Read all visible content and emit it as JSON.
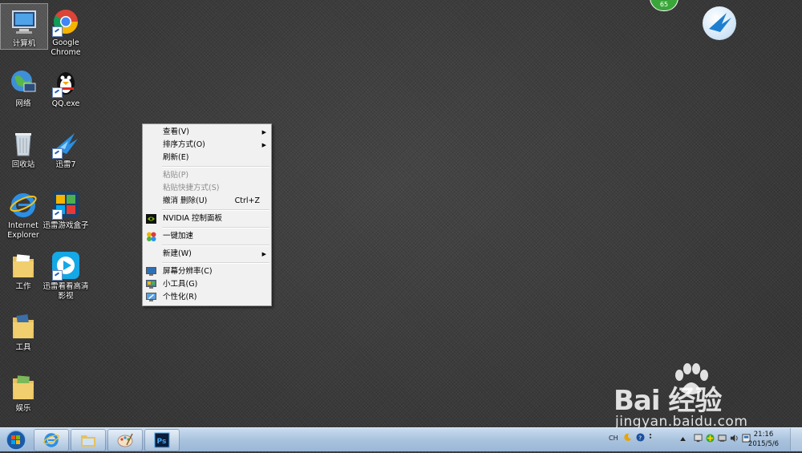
{
  "desktop": {
    "icons": [
      {
        "label": "计算机"
      },
      {
        "label": "Google Chrome"
      },
      {
        "label": "网络"
      },
      {
        "label": "QQ.exe"
      },
      {
        "label": "回收站"
      },
      {
        "label": "迅雷7"
      },
      {
        "label": "Internet Explorer"
      },
      {
        "label": "迅雷游戏盒子"
      },
      {
        "label": "工作"
      },
      {
        "label": "迅雷看看高清影视"
      },
      {
        "label": "工具"
      },
      {
        "label": "娱乐"
      }
    ],
    "badge_count": "65"
  },
  "context_menu": {
    "items": [
      {
        "label": "查看(V)"
      },
      {
        "label": "排序方式(O)"
      },
      {
        "label": "刷新(E)"
      },
      {
        "label": "粘贴(P)"
      },
      {
        "label": "粘贴快捷方式(S)"
      },
      {
        "label": "撤消 删除(U)",
        "shortcut": "Ctrl+Z"
      },
      {
        "label": "NVIDIA 控制面板"
      },
      {
        "label": "一键加速"
      },
      {
        "label": "新建(W)"
      },
      {
        "label": "屏幕分辨率(C)"
      },
      {
        "label": "小工具(G)"
      },
      {
        "label": "个性化(R)"
      }
    ]
  },
  "taskbar": {
    "tray": {
      "lang": "CH"
    },
    "clock": {
      "time": "21:16",
      "date": "2015/5/6"
    }
  },
  "watermark": {
    "logo": "Bai  经验",
    "url": "jingyan.baidu.com"
  },
  "colors": {
    "desktop": "#3b3b3b",
    "taskbar": "#a9c3de",
    "menu": "#f1f1f1"
  }
}
